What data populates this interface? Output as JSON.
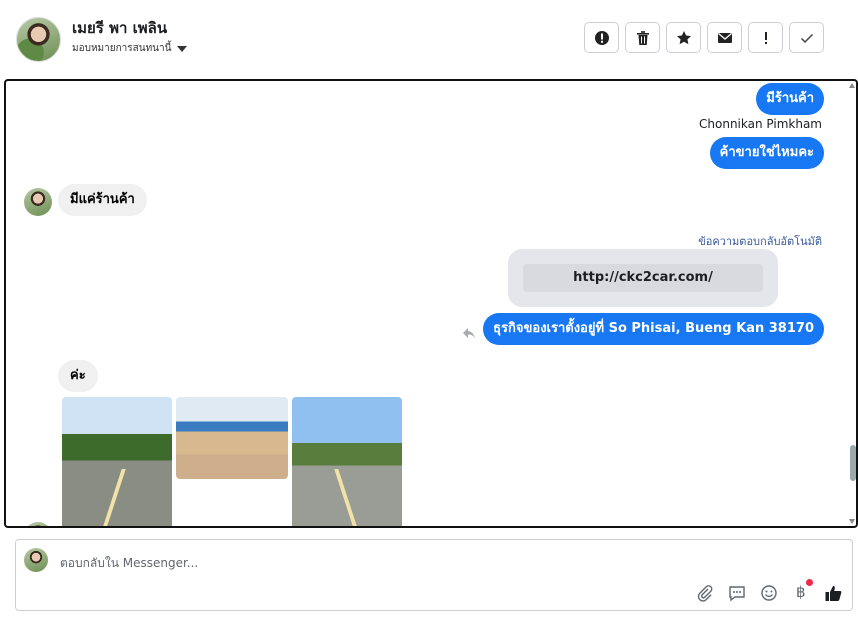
{
  "header": {
    "name": "เมยรี พา เพลิน",
    "assign_label": "มอบหมายการสนทนานี้"
  },
  "actions": [
    "spam-icon",
    "trash-icon",
    "star-icon",
    "mail-icon",
    "important-icon",
    "check-icon"
  ],
  "messages": {
    "out1": "มีร้านค้า",
    "sender": "Chonnikan Pimkham",
    "out2": "ค้าขายใช่ไหมคะ",
    "in1": "มีแค่ร้านค้า",
    "autoreply_label": "ข้อความตอบกลับอัตโนมัติ",
    "card_link": "http://ckc2car.com/",
    "out3": "ธุรกิจของเราตั้งอยู่ที่ So Phisai, Bueng Kan 38170",
    "in2": "ค่ะ"
  },
  "composer": {
    "placeholder": "ตอบกลับใน Messenger..."
  },
  "colors": {
    "accent": "#1877f2",
    "bubble_in": "#f0f0f0"
  }
}
